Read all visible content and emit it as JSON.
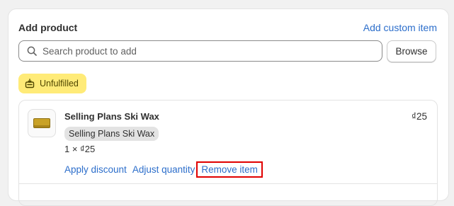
{
  "header": {
    "title": "Add product",
    "custom_link": "Add custom item"
  },
  "search": {
    "placeholder": "Search product to add",
    "icon": "search-icon",
    "browse_label": "Browse"
  },
  "status_badge": {
    "label": "Unfulfilled",
    "icon": "fulfillment-icon",
    "color": "#ffeb78"
  },
  "line_item": {
    "name": "Selling Plans Ski Wax",
    "variant": "Selling Plans Ski Wax",
    "quantity_price": "1 × ₫25",
    "total": "₫25",
    "actions": {
      "apply_discount": "Apply discount",
      "adjust_quantity": "Adjust quantity",
      "remove_item": "Remove item"
    }
  },
  "colors": {
    "link": "#2c6ecb",
    "highlight": "#e00000"
  }
}
